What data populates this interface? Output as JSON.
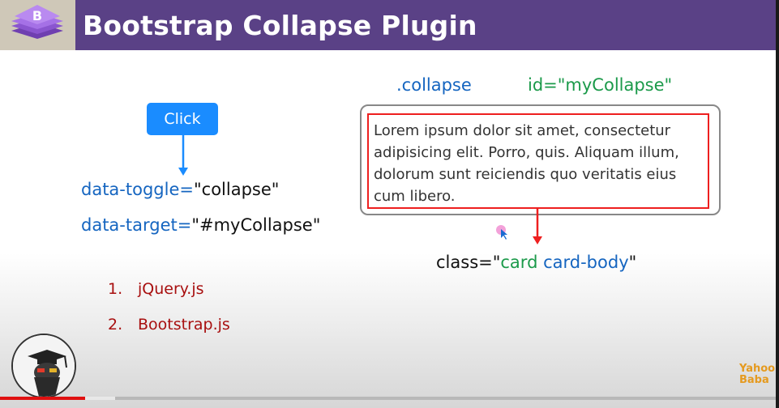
{
  "header": {
    "title": "Bootstrap Collapse Plugin",
    "logo_letter": "B"
  },
  "trigger": {
    "button_label": "Click",
    "toggle_attr": "data-toggle=",
    "toggle_value": "\"collapse\"",
    "target_attr": "data-target=",
    "target_value": "\"#myCollapse\""
  },
  "collapse_panel": {
    "class_label": ".collapse",
    "id_label": "id=\"myCollapse\"",
    "body_text": "Lorem ipsum dolor sit amet, consectetur adipisicing elit. Porro, quis. Aliquam illum, dolorum sunt reiciendis quo veritatis eius cum libero.",
    "class_attr": "class=\"",
    "class_card": "card",
    "class_card_body": "card-body",
    "class_close": "\""
  },
  "requirements": [
    {
      "num": "1.",
      "label": "jQuery.js"
    },
    {
      "num": "2.",
      "label": "Bootstrap.js"
    }
  ],
  "branding": {
    "line1": "Yahoo",
    "line2": "Baba"
  },
  "video": {
    "progress_fraction": 0.11,
    "buffer_fraction": 0.148
  },
  "colors": {
    "header_bg": "#5a4186",
    "accent_blue": "#1565c0",
    "accent_green": "#1b9a4a",
    "card_border": "#ee1f1f",
    "button_bg": "#1a8cff"
  },
  "icons": [
    "bootstrap-logo-icon",
    "arrow-down-icon",
    "cursor-icon",
    "avatar-icon"
  ]
}
